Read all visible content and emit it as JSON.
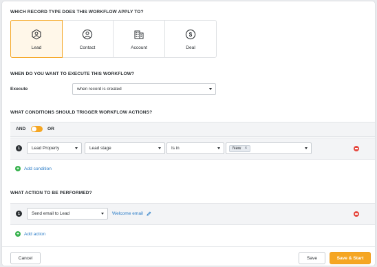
{
  "record_section": {
    "title": "WHICH RECORD TYPE DOES THIS WORKFLOW APPLY TO?",
    "types": [
      {
        "label": "Lead",
        "icon": "lead-icon",
        "selected": true
      },
      {
        "label": "Contact",
        "icon": "contact-icon",
        "selected": false
      },
      {
        "label": "Account",
        "icon": "account-icon",
        "selected": false
      },
      {
        "label": "Deal",
        "icon": "deal-icon",
        "selected": false
      }
    ]
  },
  "execute_section": {
    "title": "WHEN DO YOU WANT TO EXECUTE THIS WORKFLOW?",
    "label": "Execute",
    "value": "when record is created"
  },
  "conditions_section": {
    "title": "WHAT CONDITIONS SHOULD TRIGGER WORKFLOW ACTIONS?",
    "and_label": "AND",
    "or_label": "OR",
    "row": {
      "number": "1",
      "property": "Lead Property",
      "field": "Lead stage",
      "operator": "Is in",
      "value_chip": "New",
      "chip_remove": "×"
    },
    "add_label": "Add condition"
  },
  "action_section": {
    "title": "WHAT ACTION TO BE PERFORMED?",
    "row": {
      "number": "1",
      "action": "Send email to Lead",
      "template": "Welcome email"
    },
    "add_label": "Add action"
  },
  "footer": {
    "cancel": "Cancel",
    "save": "Save",
    "save_start": "Save & Start"
  },
  "colors": {
    "accent": "#f5a623",
    "link": "#2a7cc7",
    "add": "#37b24d",
    "remove": "#e5483f"
  }
}
